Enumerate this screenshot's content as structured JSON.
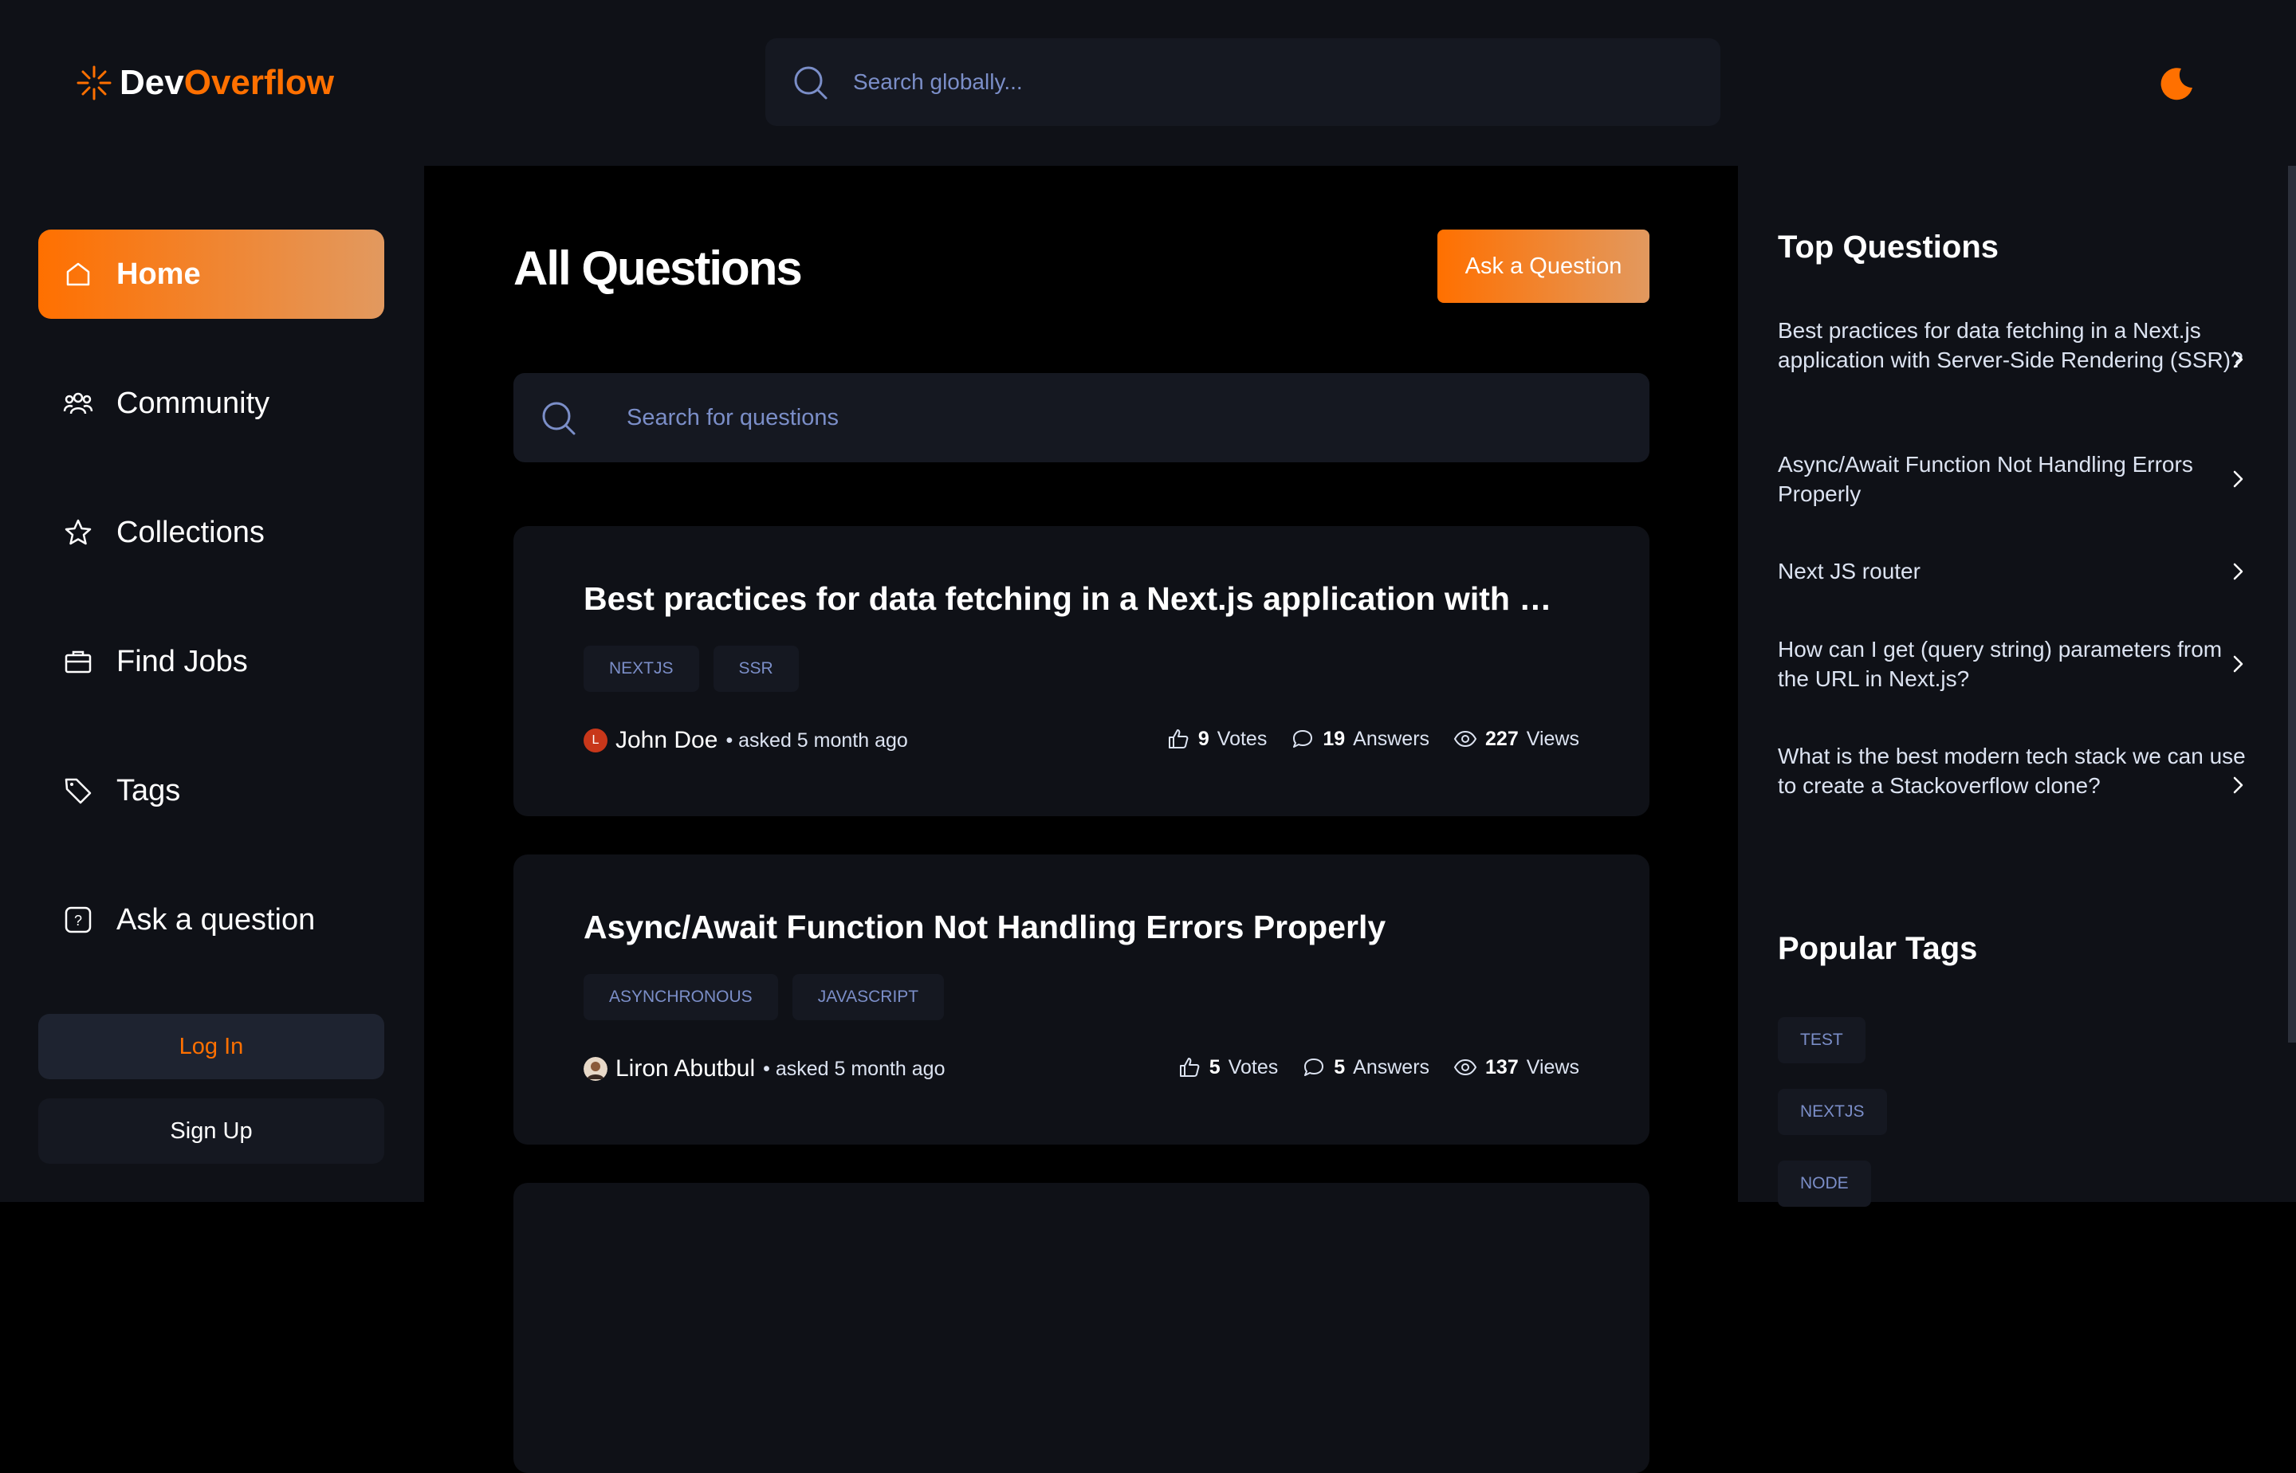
{
  "navbar": {
    "logo_part1": "Dev",
    "logo_part2": "Overflow",
    "search_placeholder": "Search globally..."
  },
  "sidebar": {
    "items": [
      {
        "label": "Home",
        "icon": "home-icon",
        "active": true
      },
      {
        "label": "Community",
        "icon": "users-icon",
        "active": false
      },
      {
        "label": "Collections",
        "icon": "star-icon",
        "active": false
      },
      {
        "label": "Find Jobs",
        "icon": "suitcase-icon",
        "active": false
      },
      {
        "label": "Tags",
        "icon": "tag-icon",
        "active": false
      },
      {
        "label": "Ask a question",
        "icon": "question-icon",
        "active": false
      }
    ],
    "login_label": "Log In",
    "signup_label": "Sign Up"
  },
  "main": {
    "title": "All Questions",
    "ask_button": "Ask a Question",
    "search_placeholder": "Search for questions",
    "questions": [
      {
        "title": "Best practices for data fetching in a Next.js application with Server-Side Rendering (SSR)?",
        "tags": [
          "NEXTJS",
          "SSR"
        ],
        "author": "John Doe",
        "author_initial": "L",
        "asked": "• asked 5 month ago",
        "votes": "9",
        "votes_label": "Votes",
        "answers": "19",
        "answers_label": "Answers",
        "views": "227",
        "views_label": "Views"
      },
      {
        "title": "Async/Await Function Not Handling Errors Properly",
        "tags": [
          "ASYNCHRONOUS",
          "JAVASCRIPT"
        ],
        "author": "Liron Abutbul",
        "author_initial": "",
        "asked": "• asked 5 month ago",
        "votes": "5",
        "votes_label": "Votes",
        "answers": "5",
        "answers_label": "Answers",
        "views": "137",
        "views_label": "Views"
      }
    ]
  },
  "right": {
    "top_questions_title": "Top Questions",
    "top_questions": [
      "Best practices for data fetching in a Next.js application with Server-Side Rendering (SSR)?",
      "Async/Await Function Not Handling Errors Properly",
      "Next JS router",
      "How can I get (query string) parameters from the URL in Next.js?",
      "What is the best modern tech stack we can use to create a Stackoverflow clone?"
    ],
    "popular_tags_title": "Popular Tags",
    "popular_tags": [
      "TEST",
      "NEXTJS",
      "NODE"
    ]
  },
  "colors": {
    "accent": "#ff7000",
    "accent_gradient_end": "#e2995f",
    "background": "#000000",
    "panel": "#0f1117",
    "input": "#151821",
    "tag_text": "#7b8ec8"
  }
}
